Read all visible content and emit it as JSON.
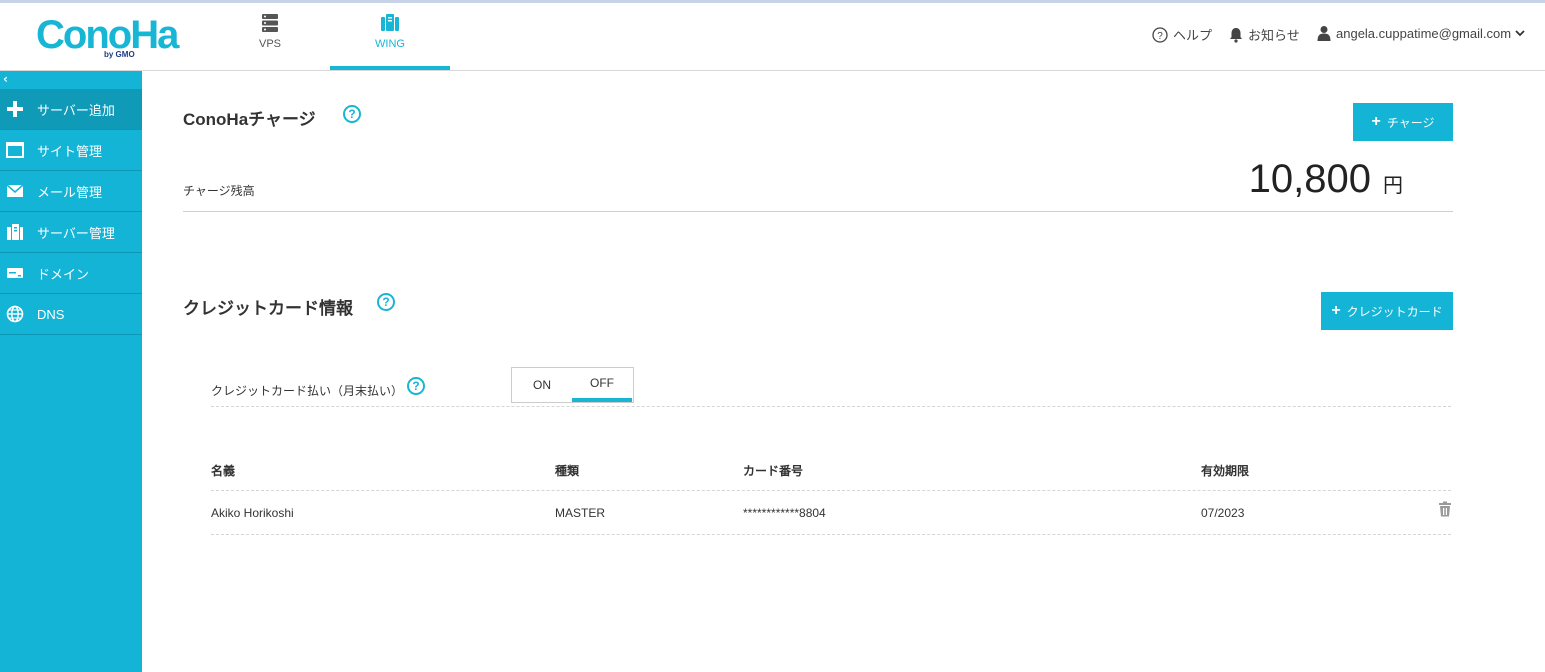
{
  "header": {
    "logo_text": "ConoHa",
    "logo_sub": "by GMO",
    "nav": [
      {
        "label": "VPS",
        "icon": "server-icon"
      },
      {
        "label": "WING",
        "icon": "wing-server-icon"
      }
    ],
    "help_label": "ヘルプ",
    "notice_label": "お知らせ",
    "account_email": "angela.cuppatime@gmail.com"
  },
  "sidebar": {
    "collapse_glyph": "‹",
    "items": [
      {
        "label": "サーバー追加",
        "icon": "plus-icon"
      },
      {
        "label": "サイト管理",
        "icon": "window-icon"
      },
      {
        "label": "メール管理",
        "icon": "mail-icon"
      },
      {
        "label": "サーバー管理",
        "icon": "server-manage-icon"
      },
      {
        "label": "ドメイン",
        "icon": "domain-icon"
      },
      {
        "label": "DNS",
        "icon": "globe-icon"
      }
    ]
  },
  "charge": {
    "title": "ConoHaチャージ",
    "button_label": "チャージ",
    "balance_label": "チャージ残高",
    "balance_value": "10,800",
    "balance_unit": "円"
  },
  "credit": {
    "title": "クレジットカード情報",
    "button_label": "クレジットカード",
    "payment_label": "クレジットカード払い（月末払い）",
    "toggle_on": "ON",
    "toggle_off": "OFF",
    "toggle_selected": "OFF",
    "columns": [
      "名義",
      "種類",
      "カード番号",
      "有効期限"
    ],
    "rows": [
      {
        "name": "Akiko Horikoshi",
        "type": "MASTER",
        "number": "************8804",
        "expiry": "07/2023"
      }
    ]
  },
  "colors": {
    "accent": "#14b4d6",
    "sidebar_active": "#0f9ab8",
    "logo_sub": "#1f3b84"
  }
}
